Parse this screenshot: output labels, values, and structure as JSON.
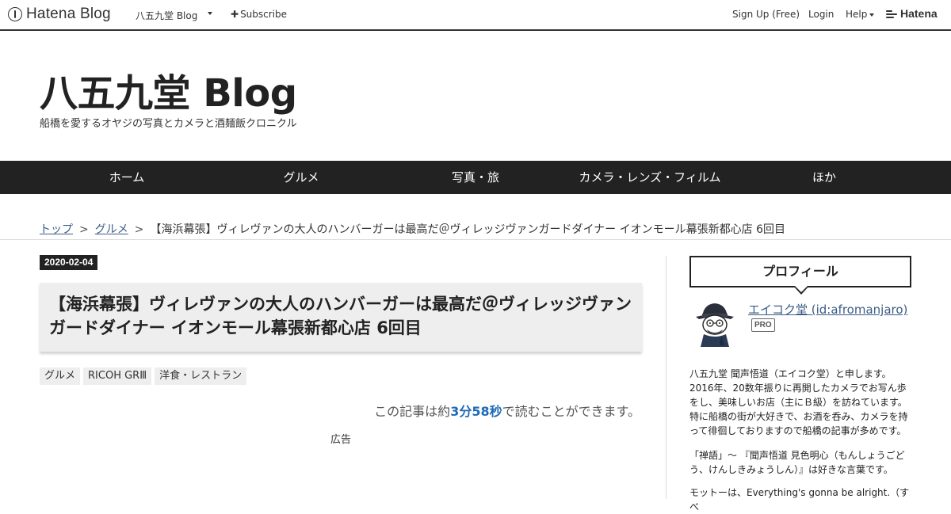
{
  "topbar": {
    "logo": "Hatena Blog",
    "blog_name": "八五九堂 Blog",
    "subscribe": "Subscribe",
    "signup": "Sign Up (Free)",
    "login": "Login",
    "help": "Help",
    "hatena": "Hatena"
  },
  "header": {
    "title": "八五九堂 Blog",
    "description": "船橋を愛するオヤジの写真とカメラと酒麺飯クロニクル"
  },
  "nav": {
    "items": [
      "ホーム",
      "グルメ",
      "写真・旅",
      "カメラ・レンズ・フィルム",
      "ほか"
    ]
  },
  "breadcrumb": {
    "top": "トップ",
    "separator": ">",
    "category": "グルメ",
    "current": "【海浜幕張】ヴィレヴァンの大人のハンバーガーは最高だ＠ヴィレッジヴァンガードダイナー イオンモール幕張新都心店 6回目"
  },
  "entry": {
    "date": "2020-02-04",
    "title": "【海浜幕張】ヴィレヴァンの大人のハンバーガーは最高だ＠ヴィレッジヴァンガードダイナー イオンモール幕張新都心店 6回目",
    "categories": [
      "グルメ",
      "RICOH GRⅢ",
      "洋食・レストラン"
    ],
    "read_prefix": "この記事は約",
    "read_time": "3分58秒",
    "read_suffix": "で読むことができます。",
    "ad_label": "広告"
  },
  "sidebar": {
    "profile_heading": "プロフィール",
    "name": "エイコク堂 (id:afromanjaro)",
    "badge": "PRO",
    "paragraphs": [
      "八五九堂 聞声悟道（エイコク堂）と申します。2016年、20数年振りに再開したカメラでお写ん歩をし、美味しいお店（主にＢ級）を訪ねています。特に船橋の街が大好きで、お酒を呑み、カメラを持って徘徊しておりますので船橋の記事が多めです。",
      "「禅語」～ 『聞声悟道 見色明心（もんしょうごどう、けんしきみょうしん）』は好きな言葉です。",
      "モットーは、Everything's gonna be alright.（すべ"
    ]
  },
  "colors": {
    "nav_bg": "#222222",
    "link": "#3b5c86",
    "read_time": "#1f6bb5",
    "title_box": "#eeeeee"
  },
  "icons": [
    "hatena-blog-logo-icon",
    "chevron-down-icon",
    "plus-icon",
    "hatena-logo-icon",
    "avatar-illustration"
  ]
}
